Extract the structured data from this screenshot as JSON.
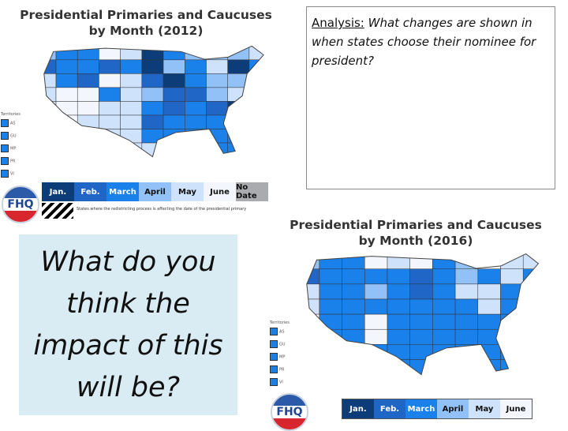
{
  "map2012": {
    "title_line1": "Presidential Primaries and Caucuses",
    "title_line2": "by Month (2012)",
    "legend": [
      {
        "label": "Jan.",
        "color": "#0d3d78",
        "text": "#fff"
      },
      {
        "label": "Feb.",
        "color": "#1f66c7",
        "text": "#fff"
      },
      {
        "label": "March",
        "color": "#1a80ea",
        "text": "#fff"
      },
      {
        "label": "April",
        "color": "#92c1f7",
        "text": "#111"
      },
      {
        "label": "May",
        "color": "#cfe2fb",
        "text": "#111"
      },
      {
        "label": "June",
        "color": "#f3f7fd",
        "text": "#111"
      },
      {
        "label": "No Date",
        "color": "#a9abae",
        "text": "#111"
      }
    ],
    "hatch_note": "States where the redistricting process is affecting the date of the presidential primary",
    "territories_label": "Territories",
    "territories": [
      "AS",
      "GU",
      "MP",
      "PR",
      "VI"
    ]
  },
  "map2016": {
    "title_line1": "Presidential Primaries and Caucuses",
    "title_line2": "by Month (2016)",
    "legend": [
      {
        "label": "Jan.",
        "color": "#0d3d78",
        "text": "#fff"
      },
      {
        "label": "Feb.",
        "color": "#1f66c7",
        "text": "#fff"
      },
      {
        "label": "March",
        "color": "#1a80ea",
        "text": "#fff"
      },
      {
        "label": "April",
        "color": "#92c1f7",
        "text": "#111"
      },
      {
        "label": "May",
        "color": "#cfe2fb",
        "text": "#111"
      },
      {
        "label": "June",
        "color": "#f3f7fd",
        "text": "#111"
      }
    ],
    "territories_label": "Territories",
    "territories": [
      "AS",
      "GU",
      "MP",
      "PR",
      "VI"
    ]
  },
  "logo_text": "FHQ",
  "analysis": {
    "label": "Analysis:",
    "question": " What changes are shown in when states choose their nominee for president?"
  },
  "prompt": "What do you think the impact of this will be?"
}
